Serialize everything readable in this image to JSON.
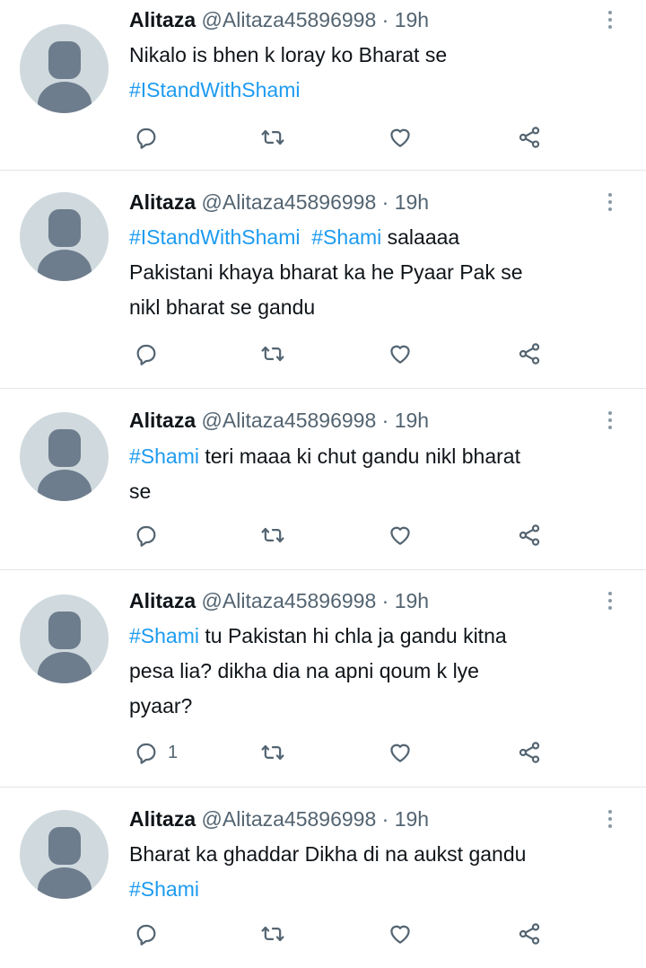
{
  "tweets": [
    {
      "author": "Alitaza",
      "handle": "@Alitaza45896998",
      "separator": "·",
      "time": "19h",
      "lines": [
        [
          {
            "text": "Nikalo is bhen k loray ko Bharat se",
            "tag": false
          }
        ],
        [
          {
            "text": "#IStandWithShami",
            "tag": true
          }
        ]
      ],
      "reply_count": ""
    },
    {
      "author": "Alitaza",
      "handle": "@Alitaza45896998",
      "separator": "·",
      "time": "19h",
      "lines": [
        [
          {
            "text": "#IStandWithShami",
            "tag": true
          },
          {
            "text": "  ",
            "tag": false
          },
          {
            "text": "#Shami",
            "tag": true
          },
          {
            "text": " salaaaa",
            "tag": false
          }
        ],
        [
          {
            "text": "Pakistani khaya bharat ka he Pyaar Pak se",
            "tag": false
          }
        ],
        [
          {
            "text": "nikl bharat se gandu",
            "tag": false
          }
        ]
      ],
      "reply_count": ""
    },
    {
      "author": "Alitaza",
      "handle": "@Alitaza45896998",
      "separator": "·",
      "time": "19h",
      "lines": [
        [
          {
            "text": "#Shami",
            "tag": true
          },
          {
            "text": " teri maaa ki chut gandu nikl bharat",
            "tag": false
          }
        ],
        [
          {
            "text": "se",
            "tag": false
          }
        ]
      ],
      "reply_count": ""
    },
    {
      "author": "Alitaza",
      "handle": "@Alitaza45896998",
      "separator": "·",
      "time": "19h",
      "lines": [
        [
          {
            "text": "#Shami",
            "tag": true
          },
          {
            "text": " tu Pakistan hi chla ja gandu kitna",
            "tag": false
          }
        ],
        [
          {
            "text": "pesa lia? dikha dia na apni qoum k lye",
            "tag": false
          }
        ],
        [
          {
            "text": "pyaar?",
            "tag": false
          }
        ]
      ],
      "reply_count": "1"
    },
    {
      "author": "Alitaza",
      "handle": "@Alitaza45896998",
      "separator": "·",
      "time": "19h",
      "lines": [
        [
          {
            "text": "Bharat ka ghaddar Dikha di na aukst gandu",
            "tag": false
          }
        ],
        [
          {
            "text": "#Shami",
            "tag": true
          }
        ]
      ],
      "reply_count": ""
    }
  ],
  "icons": {
    "reply": "reply-icon",
    "retweet": "retweet-icon",
    "like": "like-icon",
    "share": "share-icon",
    "more": "more-icon"
  },
  "colors": {
    "hashtag": "#1d9bf0",
    "secondary_text": "#536471",
    "avatar_bg": "#cfd9de",
    "avatar_fg": "#6e7d8d",
    "divider": "#e1e6ea"
  }
}
